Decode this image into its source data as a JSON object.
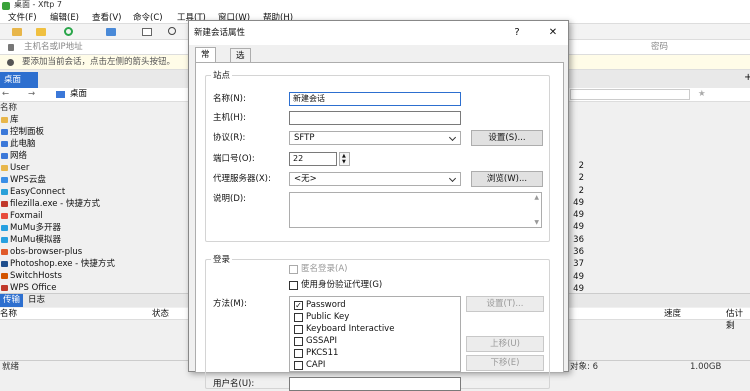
{
  "window": {
    "title": "桌面 - Xftp 7"
  },
  "menu": [
    "文件(F)",
    "编辑(E)",
    "查看(V)",
    "命令(C)",
    "工具(T)",
    "窗口(W)",
    "帮助(H)"
  ],
  "address": {
    "placeholder": "主机名或IP地址",
    "password_label": "密码"
  },
  "info": {
    "text": "要添加当前会话，点击左侧的箭头按钮。"
  },
  "local_tab": {
    "label": "桌面"
  },
  "path": {
    "value": "桌面"
  },
  "filelist": {
    "header": "名称",
    "items": [
      {
        "name": "库",
        "color": "#e8b64a"
      },
      {
        "name": "控制面板",
        "color": "#3b78d8"
      },
      {
        "name": "此电脑",
        "color": "#3b78d8"
      },
      {
        "name": "网络",
        "color": "#3b78d8"
      },
      {
        "name": "User",
        "color": "#e8b64a"
      },
      {
        "name": "WPS云盘",
        "color": "#3a8ee6"
      },
      {
        "name": "EasyConnect",
        "color": "#2aa0d8"
      },
      {
        "name": "filezilla.exe - 快捷方式",
        "color": "#c0392b"
      },
      {
        "name": "Foxmail",
        "color": "#e74c3c"
      },
      {
        "name": "MuMu多开器",
        "color": "#27a0e0"
      },
      {
        "name": "MuMu模拟器",
        "color": "#27a0e0"
      },
      {
        "name": "obs-browser-plus",
        "color": "#e05a2a"
      },
      {
        "name": "Photoshop.exe - 快捷方式",
        "color": "#1f4e8c"
      },
      {
        "name": "SwitchHosts",
        "color": "#d35400"
      },
      {
        "name": "WPS Office",
        "color": "#c0392b"
      }
    ]
  },
  "right_numbers": [
    "2",
    "2",
    "2",
    "49",
    "49",
    "49",
    "36",
    "36",
    "37",
    "49",
    "49"
  ],
  "bottom": {
    "tabs": [
      "传输",
      "日志"
    ],
    "columns": [
      "名称",
      "状态",
      "速度",
      "估计剩"
    ],
    "status_left": "就绪",
    "status_mid": "对象: 6",
    "status_size": "1.00GB"
  },
  "dialog": {
    "title": "新建会话属性",
    "help": "?",
    "close": "✕",
    "tabs": [
      "常规",
      "选项"
    ],
    "site": {
      "group": "站点",
      "name_label": "名称(N):",
      "name_value": "新建会话",
      "host_label": "主机(H):",
      "host_value": "",
      "protocol_label": "协议(R):",
      "protocol_value": "SFTP",
      "settings_btn": "设置(S)...",
      "port_label": "端口号(O):",
      "port_value": "22",
      "proxy_label": "代理服务器(X):",
      "proxy_value": "<无>",
      "browse_btn": "浏览(W)...",
      "desc_label": "说明(D):"
    },
    "login": {
      "group": "登录",
      "anonymous": "匿名登录(A)",
      "agent": "使用身份验证代理(G)",
      "method_label": "方法(M):",
      "methods": [
        {
          "label": "Password",
          "checked": "✓"
        },
        {
          "label": "Public Key",
          "checked": ""
        },
        {
          "label": "Keyboard Interactive",
          "checked": ""
        },
        {
          "label": "GSSAPI",
          "checked": ""
        },
        {
          "label": "PKCS11",
          "checked": ""
        },
        {
          "label": "CAPI",
          "checked": ""
        }
      ],
      "settings_btn": "设置(T)...",
      "up_btn": "上移(U)",
      "down_btn": "下移(E)",
      "user_label": "用户名(U):"
    }
  }
}
